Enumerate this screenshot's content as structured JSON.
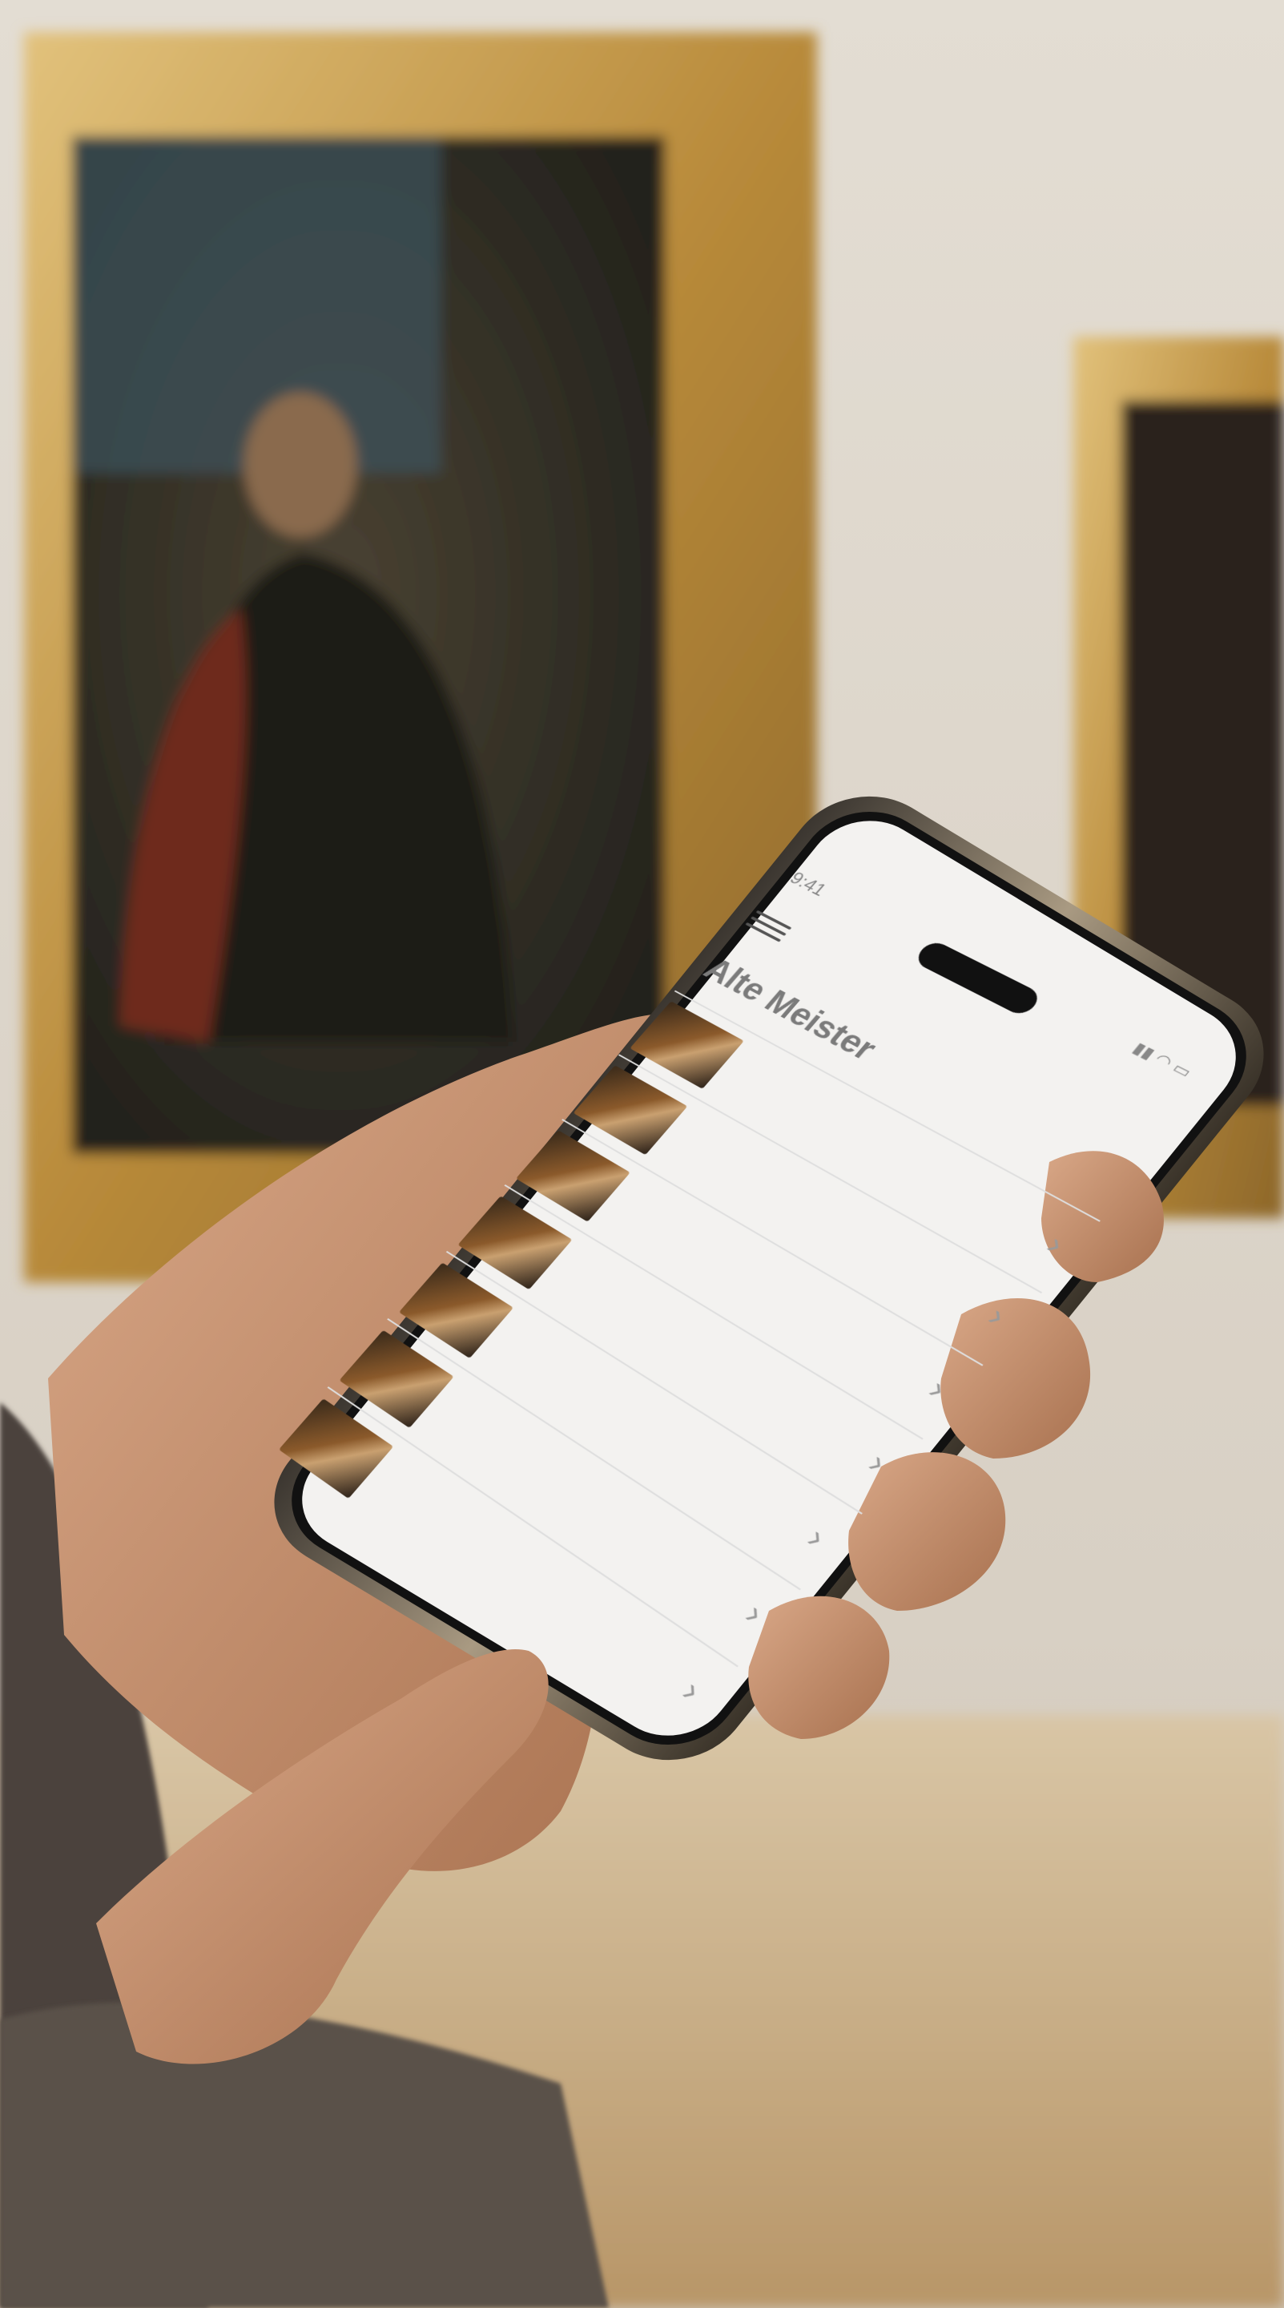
{
  "status_bar": {
    "time": "9:41",
    "icons": [
      "signal-icon",
      "wifi-icon",
      "battery-icon"
    ]
  },
  "app": {
    "title": "Alte Meister"
  },
  "list": [
    {
      "title": "",
      "subtitle": ""
    },
    {
      "title": "",
      "subtitle": ""
    },
    {
      "title": "",
      "subtitle": ""
    },
    {
      "title": "",
      "subtitle": ""
    },
    {
      "title": "",
      "subtitle": ""
    },
    {
      "title": "",
      "subtitle": ""
    },
    {
      "title": "",
      "subtitle": ""
    }
  ],
  "colors": {
    "frame_gold": "#b88a3a",
    "wall": "#d8d2c8",
    "screen_bg": "#f3f2f0"
  }
}
